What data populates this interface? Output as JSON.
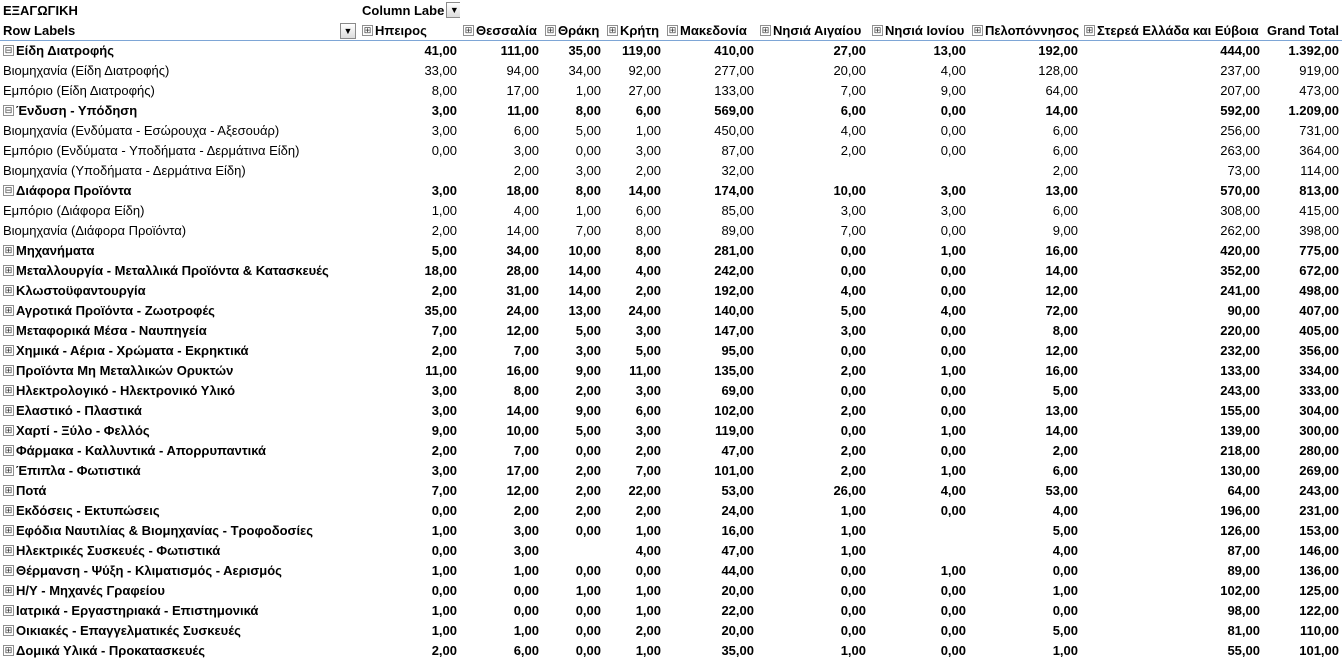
{
  "pivot": {
    "sheet_title": "ΕΞΑΓΩΓΙΚΗ",
    "column_labels_caption": "Column Labe",
    "row_labels_caption": "Row Labels",
    "expand_symbol": "⊞",
    "collapse_symbol": "⊟",
    "dropdown_symbol": "▼",
    "columns": [
      "Ηπειρος",
      "Θεσσαλία",
      "Θράκη",
      "Κρήτη",
      "Μακεδονία",
      "Νησιά Αιγαίου",
      "Νησιά Ιονίου",
      "Πελοπόννησος",
      "Στερεά Ελλάδα και Εύβοια",
      "Grand Total"
    ],
    "rows": [
      {
        "type": "group",
        "expanded": true,
        "label": "Είδη Διατροφής",
        "values": [
          "41,00",
          "111,00",
          "35,00",
          "119,00",
          "410,00",
          "27,00",
          "13,00",
          "192,00",
          "444,00",
          "1.392,00"
        ]
      },
      {
        "type": "item",
        "label": "Βιομηχανία (Είδη Διατροφής)",
        "values": [
          "33,00",
          "94,00",
          "34,00",
          "92,00",
          "277,00",
          "20,00",
          "4,00",
          "128,00",
          "237,00",
          "919,00"
        ]
      },
      {
        "type": "item",
        "label": "Εμπόριο (Είδη Διατροφής)",
        "values": [
          "8,00",
          "17,00",
          "1,00",
          "27,00",
          "133,00",
          "7,00",
          "9,00",
          "64,00",
          "207,00",
          "473,00"
        ]
      },
      {
        "type": "group",
        "expanded": true,
        "label": "Ένδυση - Υπόδηση",
        "values": [
          "3,00",
          "11,00",
          "8,00",
          "6,00",
          "569,00",
          "6,00",
          "0,00",
          "14,00",
          "592,00",
          "1.209,00"
        ]
      },
      {
        "type": "item",
        "label": "Βιομηχανία (Ενδύματα - Εσώρουχα - Αξεσουάρ)",
        "values": [
          "3,00",
          "6,00",
          "5,00",
          "1,00",
          "450,00",
          "4,00",
          "0,00",
          "6,00",
          "256,00",
          "731,00"
        ]
      },
      {
        "type": "item",
        "label": "Εμπόριο (Ενδύματα - Υποδήματα - Δερμάτινα Είδη)",
        "values": [
          "0,00",
          "3,00",
          "0,00",
          "3,00",
          "87,00",
          "2,00",
          "0,00",
          "6,00",
          "263,00",
          "364,00"
        ]
      },
      {
        "type": "item",
        "label": "Βιομηχανία (Υποδήματα - Δερμάτινα Είδη)",
        "values": [
          "",
          "2,00",
          "3,00",
          "2,00",
          "32,00",
          "",
          "",
          "2,00",
          "73,00",
          "114,00"
        ]
      },
      {
        "type": "group",
        "expanded": true,
        "label": "Διάφορα Προϊόντα",
        "values": [
          "3,00",
          "18,00",
          "8,00",
          "14,00",
          "174,00",
          "10,00",
          "3,00",
          "13,00",
          "570,00",
          "813,00"
        ]
      },
      {
        "type": "item",
        "label": "Εμπόριο (Διάφορα Είδη)",
        "values": [
          "1,00",
          "4,00",
          "1,00",
          "6,00",
          "85,00",
          "3,00",
          "3,00",
          "6,00",
          "308,00",
          "415,00"
        ]
      },
      {
        "type": "item",
        "label": "Βιομηχανία (Διάφορα Προϊόντα)",
        "values": [
          "2,00",
          "14,00",
          "7,00",
          "8,00",
          "89,00",
          "7,00",
          "0,00",
          "9,00",
          "262,00",
          "398,00"
        ]
      },
      {
        "type": "group",
        "expanded": false,
        "label": "Μηχανήματα",
        "values": [
          "5,00",
          "34,00",
          "10,00",
          "8,00",
          "281,00",
          "0,00",
          "1,00",
          "16,00",
          "420,00",
          "775,00"
        ]
      },
      {
        "type": "group",
        "expanded": false,
        "label": "Μεταλλουργία - Μεταλλικά Προϊόντα & Κατασκευές",
        "values": [
          "18,00",
          "28,00",
          "14,00",
          "4,00",
          "242,00",
          "0,00",
          "0,00",
          "14,00",
          "352,00",
          "672,00"
        ]
      },
      {
        "type": "group",
        "expanded": false,
        "label": "Κλωστοϋφαντουργία",
        "values": [
          "2,00",
          "31,00",
          "14,00",
          "2,00",
          "192,00",
          "4,00",
          "0,00",
          "12,00",
          "241,00",
          "498,00"
        ]
      },
      {
        "type": "group",
        "expanded": false,
        "label": "Αγροτικά Προϊόντα - Ζωοτροφές",
        "values": [
          "35,00",
          "24,00",
          "13,00",
          "24,00",
          "140,00",
          "5,00",
          "4,00",
          "72,00",
          "90,00",
          "407,00"
        ]
      },
      {
        "type": "group",
        "expanded": false,
        "label": "Μεταφορικά Μέσα - Ναυπηγεία",
        "values": [
          "7,00",
          "12,00",
          "5,00",
          "3,00",
          "147,00",
          "3,00",
          "0,00",
          "8,00",
          "220,00",
          "405,00"
        ]
      },
      {
        "type": "group",
        "expanded": false,
        "label": "Χημικά - Αέρια - Χρώματα - Εκρηκτικά",
        "values": [
          "2,00",
          "7,00",
          "3,00",
          "5,00",
          "95,00",
          "0,00",
          "0,00",
          "12,00",
          "232,00",
          "356,00"
        ]
      },
      {
        "type": "group",
        "expanded": false,
        "label": "Προϊόντα Μη Μεταλλικών Ορυκτών",
        "values": [
          "11,00",
          "16,00",
          "9,00",
          "11,00",
          "135,00",
          "2,00",
          "1,00",
          "16,00",
          "133,00",
          "334,00"
        ]
      },
      {
        "type": "group",
        "expanded": false,
        "label": "Ηλεκτρολογικό - Ηλεκτρονικό Υλικό",
        "values": [
          "3,00",
          "8,00",
          "2,00",
          "3,00",
          "69,00",
          "0,00",
          "0,00",
          "5,00",
          "243,00",
          "333,00"
        ]
      },
      {
        "type": "group",
        "expanded": false,
        "label": "Ελαστικό - Πλαστικά",
        "values": [
          "3,00",
          "14,00",
          "9,00",
          "6,00",
          "102,00",
          "2,00",
          "0,00",
          "13,00",
          "155,00",
          "304,00"
        ]
      },
      {
        "type": "group",
        "expanded": false,
        "label": "Χαρτί - Ξύλο - Φελλός",
        "values": [
          "9,00",
          "10,00",
          "5,00",
          "3,00",
          "119,00",
          "0,00",
          "1,00",
          "14,00",
          "139,00",
          "300,00"
        ]
      },
      {
        "type": "group",
        "expanded": false,
        "label": "Φάρμακα - Καλλυντικά - Απορρυπαντικά",
        "values": [
          "2,00",
          "7,00",
          "0,00",
          "2,00",
          "47,00",
          "2,00",
          "0,00",
          "2,00",
          "218,00",
          "280,00"
        ]
      },
      {
        "type": "group",
        "expanded": false,
        "label": "Έπιπλα - Φωτιστικά",
        "values": [
          "3,00",
          "17,00",
          "2,00",
          "7,00",
          "101,00",
          "2,00",
          "1,00",
          "6,00",
          "130,00",
          "269,00"
        ]
      },
      {
        "type": "group",
        "expanded": false,
        "label": "Ποτά",
        "values": [
          "7,00",
          "12,00",
          "2,00",
          "22,00",
          "53,00",
          "26,00",
          "4,00",
          "53,00",
          "64,00",
          "243,00"
        ]
      },
      {
        "type": "group",
        "expanded": false,
        "label": "Εκδόσεις - Εκτυπώσεις",
        "values": [
          "0,00",
          "2,00",
          "2,00",
          "2,00",
          "24,00",
          "1,00",
          "0,00",
          "4,00",
          "196,00",
          "231,00"
        ]
      },
      {
        "type": "group",
        "expanded": false,
        "label": "Εφόδια Ναυτιλίας & Βιομηχανίας - Τροφοδοσίες",
        "values": [
          "1,00",
          "3,00",
          "0,00",
          "1,00",
          "16,00",
          "1,00",
          "",
          "5,00",
          "126,00",
          "153,00"
        ]
      },
      {
        "type": "group",
        "expanded": false,
        "label": "Ηλεκτρικές Συσκευές - Φωτιστικά",
        "values": [
          "0,00",
          "3,00",
          "",
          "4,00",
          "47,00",
          "1,00",
          "",
          "4,00",
          "87,00",
          "146,00"
        ]
      },
      {
        "type": "group",
        "expanded": false,
        "label": "Θέρμανση - Ψύξη - Κλιματισμός - Αερισμός",
        "values": [
          "1,00",
          "1,00",
          "0,00",
          "0,00",
          "44,00",
          "0,00",
          "1,00",
          "0,00",
          "89,00",
          "136,00"
        ]
      },
      {
        "type": "group",
        "expanded": false,
        "label": "Η/Υ - Μηχανές Γραφείου",
        "values": [
          "0,00",
          "0,00",
          "1,00",
          "1,00",
          "20,00",
          "0,00",
          "0,00",
          "1,00",
          "102,00",
          "125,00"
        ]
      },
      {
        "type": "group",
        "expanded": false,
        "label": "Ιατρικά - Εργαστηριακά - Επιστημονικά",
        "values": [
          "1,00",
          "0,00",
          "0,00",
          "1,00",
          "22,00",
          "0,00",
          "0,00",
          "0,00",
          "98,00",
          "122,00"
        ]
      },
      {
        "type": "group",
        "expanded": false,
        "label": "Οικιακές - Επαγγελματικές Συσκευές",
        "values": [
          "1,00",
          "1,00",
          "0,00",
          "2,00",
          "20,00",
          "0,00",
          "0,00",
          "5,00",
          "81,00",
          "110,00"
        ]
      },
      {
        "type": "group",
        "expanded": false,
        "label": "Δομικά Υλικά - Προκατασκευές",
        "values": [
          "2,00",
          "6,00",
          "0,00",
          "1,00",
          "35,00",
          "1,00",
          "0,00",
          "1,00",
          "55,00",
          "101,00"
        ]
      }
    ]
  }
}
